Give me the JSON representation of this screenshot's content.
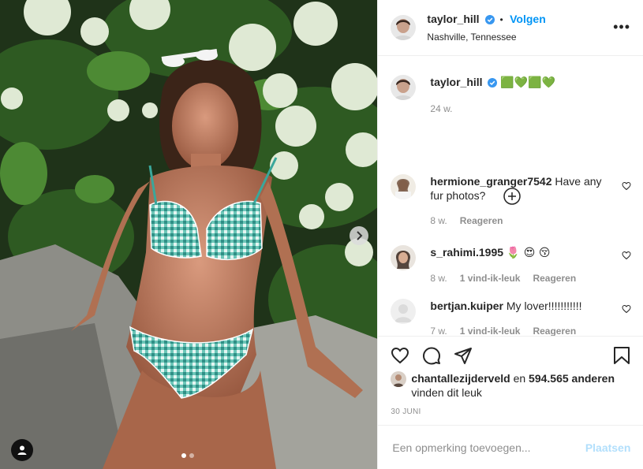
{
  "post": {
    "username": "taylor_hill",
    "follow_label": "Volgen",
    "separator": "•",
    "location": "Nashville, Tennessee",
    "more_label": "•••"
  },
  "caption": {
    "username": "taylor_hill",
    "text": "🟩💚🟩💚",
    "time": "24 w."
  },
  "comments": [
    {
      "username": "hermione_granger7542",
      "text": "Have any fur photos?",
      "time": "8 w.",
      "likes": "",
      "reply": "Reageren"
    },
    {
      "username": "s_rahimi.1995",
      "text": "🌷 😍 😚",
      "time": "8 w.",
      "likes": "1 vind-ik-leuk",
      "reply": "Reageren"
    },
    {
      "username": "bertjan.kuiper",
      "text": "My lover!!!!!!!!!!!",
      "time": "7 w.",
      "likes": "1 vind-ik-leuk",
      "reply": "Reageren"
    }
  ],
  "likes": {
    "user": "chantallezijderveld",
    "connector": "en",
    "count": "594.565 anderen",
    "suffix": "vinden dit leuk"
  },
  "date": "30 JUNI",
  "comment_input": {
    "placeholder": "Een opmerking toevoegen...",
    "post_label": "Plaatsen"
  },
  "carousel": {
    "current": 1,
    "total": 2
  },
  "colors": {
    "accent": "#0095f6",
    "verified": "#3897f0",
    "post_disabled": "#b2dffc"
  },
  "icons": [
    "chevron-right-icon",
    "user-tag-icon",
    "verified-icon",
    "plus-circle-icon",
    "heart-icon",
    "comment-icon",
    "share-icon",
    "bookmark-icon"
  ]
}
